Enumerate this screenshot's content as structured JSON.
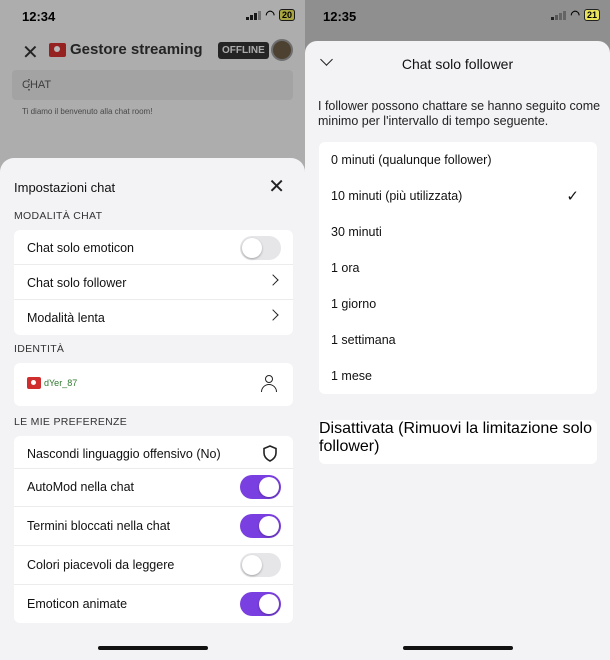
{
  "left": {
    "status": {
      "time": "12:34",
      "battery": "20"
    },
    "app_title": "Gestore streaming",
    "offline_badge": "OFFLINE",
    "chat_header": "CHAT",
    "welcome_text": "Ti diamo il benvenuto alla chat room!",
    "sheet": {
      "title": "Impostazioni chat",
      "sections": {
        "mode": "MODALITÀ CHAT",
        "identity": "IDENTITÀ",
        "prefs": "LE MIE PREFERENZE"
      },
      "mode_items": [
        {
          "label": "Chat solo emoticon",
          "toggle": false
        },
        {
          "label": "Chat solo follower"
        },
        {
          "label": "Modalità lenta"
        }
      ],
      "identity_name": "dYer_87",
      "pref_items": [
        {
          "label": "Nascondi linguaggio offensivo (No)"
        },
        {
          "label": "AutoMod nella chat",
          "toggle": true
        },
        {
          "label": "Termini bloccati nella chat",
          "toggle": true
        },
        {
          "label": "Colori piacevoli da leggere",
          "toggle": false
        },
        {
          "label": "Emoticon animate",
          "toggle": true
        }
      ]
    }
  },
  "right": {
    "status": {
      "time": "12:35",
      "battery": "21"
    },
    "title": "Chat solo follower",
    "description": "I follower possono chattare se hanno seguito come minimo per l'intervallo di tempo seguente.",
    "options": [
      "0 minuti (qualunque follower)",
      "10 minuti (più utilizzata)",
      "30 minuti",
      "1 ora",
      "1 giorno",
      "1 settimana",
      "1 mese"
    ],
    "selected_option": "10 minuti (più utilizzata)",
    "check_mark": "✓",
    "disable_option": "Disattivata (Rimuovi la limitazione solo follower)"
  },
  "colors": {
    "accent": "#7a3fe0",
    "brand_red": "#d02e2e"
  },
  "icons": [
    "close-icon",
    "camera-icon",
    "avatar",
    "more-icon",
    "chevron-right-icon",
    "user-icon",
    "shield-icon",
    "chevron-down-icon",
    "check-icon"
  ]
}
